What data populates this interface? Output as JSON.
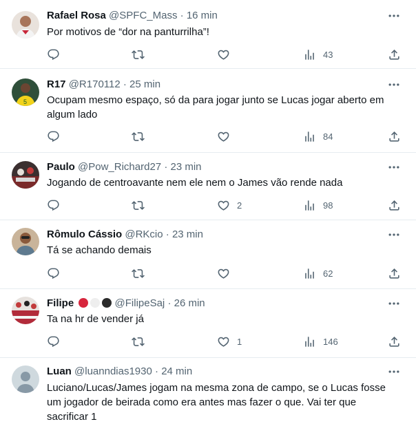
{
  "replies": [
    {
      "name": "Rafael Rosa",
      "handle": "@SPFC_Mass",
      "time": "16 min",
      "text": "Por motivos de “dor na panturrilha”!",
      "replies_count": "",
      "retweets": "",
      "likes": "",
      "views": "43"
    },
    {
      "name": "R17",
      "handle": "@R170112",
      "time": "25 min",
      "text": "Ocupam mesmo espaço, só da para jogar junto se Lucas jogar aberto em algum lado",
      "replies_count": "",
      "retweets": "",
      "likes": "",
      "views": "84"
    },
    {
      "name": "Paulo",
      "handle": "@Pow_Richard27",
      "time": "23 min",
      "text": "Jogando de centroavante nem ele nem o James vão rende nada",
      "replies_count": "",
      "retweets": "",
      "likes": "2",
      "views": "98"
    },
    {
      "name": "Rômulo Cássio",
      "handle": "@RKcio",
      "time": "23 min",
      "text": "Tá se achando demais",
      "replies_count": "",
      "retweets": "",
      "likes": "",
      "views": "62"
    },
    {
      "name": "Filipe",
      "handle": "@FilipeSaj",
      "time": "26 min",
      "text": "Ta na hr de vender já",
      "replies_count": "",
      "retweets": "",
      "likes": "1",
      "views": "146",
      "badge_colors": [
        "#d7263d",
        "#eeeeee",
        "#2b2b2b"
      ]
    },
    {
      "name": "Luan",
      "handle": "@luanndias1930",
      "time": "24 min",
      "text": "Luciano/Lucas/James jogam na mesma zona de campo, se o Lucas fosse um jogador de beirada como era antes mas fazer o que. Vai ter que sacrificar 1",
      "replies_count": "",
      "retweets": "",
      "likes": "",
      "views": ""
    }
  ],
  "separator": "·",
  "icons": {
    "reply": "reply-icon",
    "retweet": "retweet-icon",
    "like": "like-icon",
    "views": "views-icon",
    "share": "share-icon",
    "more": "more-icon"
  },
  "colors": {
    "text": "#0f1419",
    "secondary": "#536471",
    "border": "#e6ecf0"
  }
}
